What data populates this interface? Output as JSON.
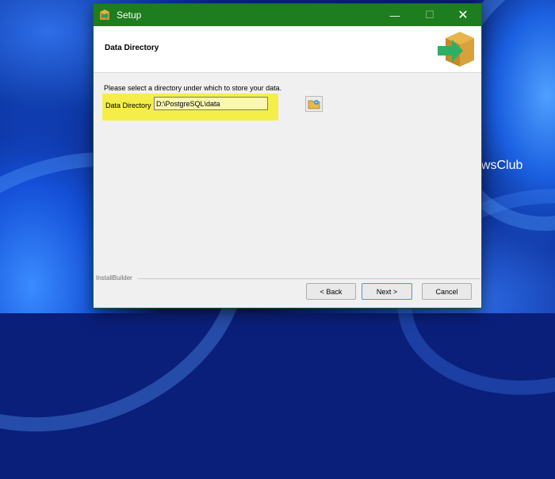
{
  "window": {
    "title": "Setup",
    "minimize_glyph": "—",
    "maximize_glyph": "☐",
    "close_glyph": "✕"
  },
  "header": {
    "title": "Data Directory"
  },
  "content": {
    "instruction": "Please select a directory under which to store your data.",
    "directory_label": "Data Directory",
    "directory_value": "D:\\PostgreSQL\\data"
  },
  "footer": {
    "label": "InstallBuilder",
    "back_label": "< Back",
    "next_label": "Next >",
    "cancel_label": "Cancel"
  },
  "watermark": {
    "text": "TheWindowsClub"
  },
  "colors": {
    "titlebar": "#1e7d1e",
    "highlight": "#f5ee4a",
    "dialog_bg": "#f0f0f0"
  },
  "icons": [
    "app-setup-icon",
    "installer-box-arrow-icon",
    "folder-browse-icon",
    "windows-logo-icon"
  ]
}
